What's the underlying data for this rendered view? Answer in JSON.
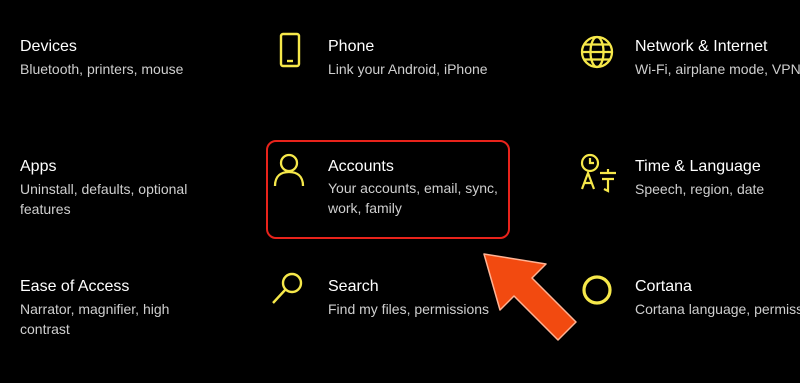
{
  "accent_color": "#f6e84a",
  "highlight_color": "#e8231b",
  "arrow_color": "#f24a10",
  "tiles": [
    {
      "id": "devices",
      "title": "Devices",
      "description": "Bluetooth, printers, mouse",
      "icon": "devices-icon"
    },
    {
      "id": "phone",
      "title": "Phone",
      "description": "Link your Android, iPhone",
      "icon": "phone-icon"
    },
    {
      "id": "network",
      "title": "Network & Internet",
      "description": "Wi-Fi, airplane mode, VPN",
      "icon": "globe-icon"
    },
    {
      "id": "apps",
      "title": "Apps",
      "description": "Uninstall, defaults, optional features",
      "icon": "apps-icon"
    },
    {
      "id": "accounts",
      "title": "Accounts",
      "description": "Your accounts, email, sync, work, family",
      "icon": "person-icon"
    },
    {
      "id": "time",
      "title": "Time & Language",
      "description": "Speech, region, date",
      "icon": "time-language-icon"
    },
    {
      "id": "ease",
      "title": "Ease of Access",
      "description": "Narrator, magnifier, high contrast",
      "icon": "ease-of-access-icon"
    },
    {
      "id": "search",
      "title": "Search",
      "description": "Find my files, permissions",
      "icon": "search-icon"
    },
    {
      "id": "cortana",
      "title": "Cortana",
      "description": "Cortana language, permissions, notifications",
      "icon": "cortana-icon"
    }
  ]
}
